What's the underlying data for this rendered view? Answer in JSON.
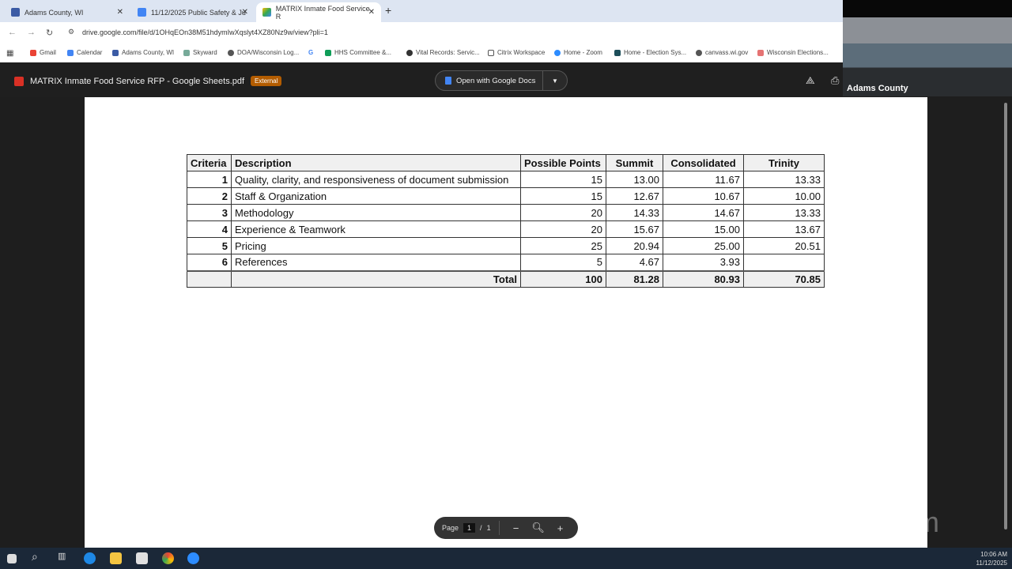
{
  "browser": {
    "tabs": [
      {
        "label": "Adams County, WI",
        "active": false
      },
      {
        "label": "11/12/2025 Public Safety & Ju",
        "active": false
      },
      {
        "label": "MATRIX Inmate Food Service R",
        "active": true
      }
    ],
    "url": "drive.google.com/file/d/1OHqEOn38M51hdymIwXqslyt4XZ80Nz9w/view?pli=1",
    "bookmarks": [
      "Gmail",
      "Calendar",
      "Adams County, WI",
      "Skyward",
      "DOA/Wisconsin Log...",
      "HHS Committee &...",
      "Vital Records: Servic...",
      "Citrix Workspace",
      "Home - Zoom",
      "Home - Election Sys...",
      "canvass.wi.gov",
      "Wisconsin Elections..."
    ]
  },
  "viewer": {
    "file_title": "MATRIX Inmate Food Service RFP - Google Sheets.pdf",
    "badge": "External",
    "open_with": "Open with Google Docs"
  },
  "video": {
    "label": "Adams County"
  },
  "table": {
    "headers": [
      "Criteria",
      "Description",
      "Possible Points",
      "Summit",
      "Consolidated",
      "Trinity"
    ],
    "rows": [
      [
        "1",
        "Quality, clarity, and responsiveness of document submission",
        "15",
        "13.00",
        "11.67",
        "13.33"
      ],
      [
        "2",
        "Staff & Organization",
        "15",
        "12.67",
        "10.67",
        "10.00"
      ],
      [
        "3",
        "Methodology",
        "20",
        "14.33",
        "14.67",
        "13.33"
      ],
      [
        "4",
        "Experience & Teamwork",
        "20",
        "15.67",
        "15.00",
        "13.67"
      ],
      [
        "5",
        "Pricing",
        "25",
        "20.94",
        "25.00",
        "20.51"
      ],
      [
        "6",
        "References",
        "5",
        "4.67",
        "3.93",
        ""
      ]
    ],
    "total": {
      "label": "Total",
      "points": "100",
      "summit": "81.28",
      "consolidated": "80.93",
      "trinity": "70.85"
    }
  },
  "pager": {
    "label": "Page",
    "current": "1",
    "separator": "/",
    "total": "1"
  },
  "watermark": "zoom",
  "clock": {
    "time": "10:06 AM",
    "date": "11/12/2025"
  }
}
